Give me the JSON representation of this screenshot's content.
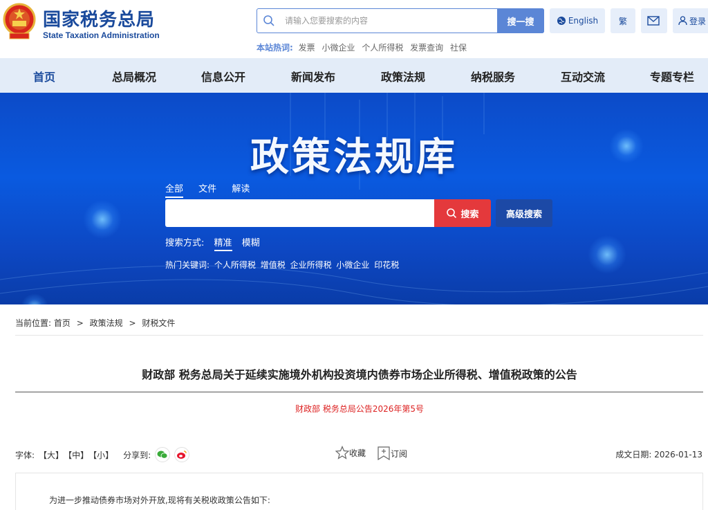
{
  "header": {
    "logo_cn": "国家税务总局",
    "logo_en": "State Taxation Administration",
    "search_placeholder": "请输入您要搜索的内容",
    "search_button": "搜一搜",
    "english_label": "English",
    "traditional_label": "繁",
    "login_label": "登录",
    "hot_label": "本站热词:",
    "hot_words": [
      "发票",
      "小微企业",
      "个人所得税",
      "发票查询",
      "社保"
    ]
  },
  "nav": {
    "items": [
      "首页",
      "总局概况",
      "信息公开",
      "新闻发布",
      "政策法规",
      "纳税服务",
      "互动交流",
      "专题专栏"
    ],
    "active_index": 0
  },
  "banner": {
    "title": "政策法规库",
    "tabs": [
      "全部",
      "文件",
      "解读"
    ],
    "search_button": "搜索",
    "advanced_button": "高级搜索",
    "search_mode_label": "搜索方式:",
    "search_modes": [
      "精准",
      "模糊"
    ],
    "hot_keys_label": "热门关键词:",
    "hot_keys": [
      "个人所得税",
      "增值税",
      "企业所得税",
      "小微企业",
      "印花税"
    ]
  },
  "breadcrumb": {
    "label": "当前位置:",
    "items": [
      "首页",
      "政策法规",
      "财税文件"
    ],
    "separator": ">"
  },
  "article": {
    "title": "财政部 税务总局关于延续实施境外机构投资境内债券市场企业所得税、增值税政策的公告",
    "doc_number": "财政部 税务总局公告2026年第5号",
    "font_label": "字体:",
    "font_sizes": [
      "【大】",
      "【中】",
      "【小】"
    ],
    "share_label": "分享到:",
    "favorite_label": "收藏",
    "subscribe_label": "订阅",
    "date_label": "成文日期:",
    "date_value": "2026-01-13",
    "body_first_line": "为进一步推动债券市场对外开放,现将有关税收政策公告如下:"
  },
  "colors": {
    "brand_blue": "#1a4a9c",
    "search_blue": "#5b86d6",
    "nav_bg": "#e3ecf8",
    "banner_red": "#e4393c",
    "doc_number_red": "#dd2222"
  }
}
